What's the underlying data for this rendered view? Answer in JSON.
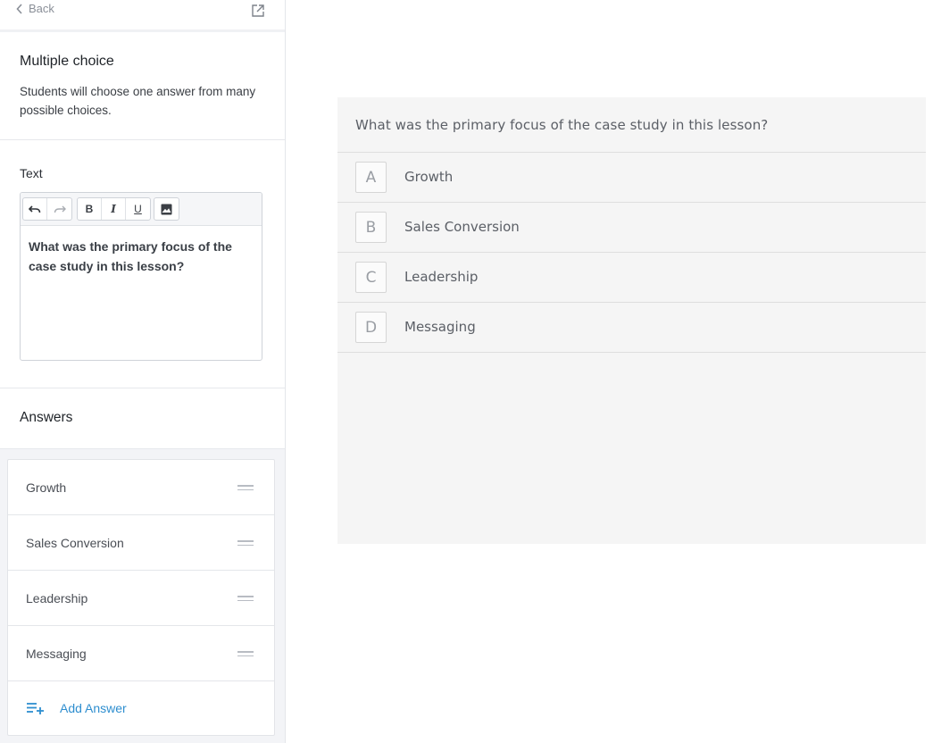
{
  "sidebar": {
    "back_label": "Back",
    "section_title": "Multiple choice",
    "section_description": "Students will choose one answer from many possible choices.",
    "text_label": "Text",
    "toolbar": {
      "bold": "B",
      "italic": "I",
      "underline": "U"
    },
    "editor_content": "What was the primary focus of the case study in this lesson?",
    "answers_heading": "Answers",
    "answers": [
      {
        "label": "Growth"
      },
      {
        "label": "Sales Conversion"
      },
      {
        "label": "Leadership"
      },
      {
        "label": "Messaging"
      }
    ],
    "add_answer_label": "Add Answer"
  },
  "preview": {
    "question": "What was the primary focus of the case study in this lesson?",
    "choices": [
      {
        "letter": "A",
        "label": "Growth"
      },
      {
        "letter": "B",
        "label": "Sales Conversion"
      },
      {
        "letter": "C",
        "label": "Leadership"
      },
      {
        "letter": "D",
        "label": "Messaging"
      }
    ]
  },
  "colors": {
    "accent": "#2e8ecf",
    "preview_background": "#f5f5f5",
    "answers_background": "#f3f4f7"
  },
  "icons": {
    "back": "chevron-left-icon",
    "popout": "external-link-icon",
    "undo": "undo-icon",
    "redo": "redo-icon",
    "image": "image-icon",
    "drag": "drag-handle-icon",
    "add": "add-list-icon"
  }
}
